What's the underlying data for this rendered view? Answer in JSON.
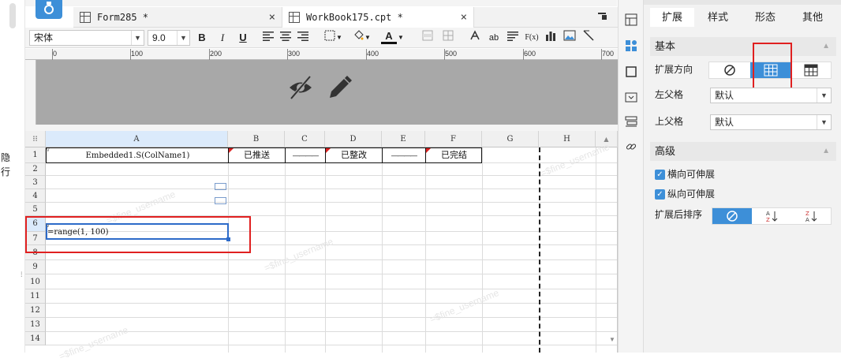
{
  "left_strip": {
    "text1": "隐",
    "text2": "行"
  },
  "tabs": [
    {
      "label": "Form285 *",
      "close": "×"
    },
    {
      "label": "WorkBook175.cpt *",
      "close": "×"
    }
  ],
  "toolbar": {
    "font_name": "宋体",
    "font_size": "9.0",
    "bold": "B",
    "italic": "I",
    "underline": "U",
    "text_color_label": "A",
    "ab_label": "ab",
    "fx_label": "F(x)"
  },
  "ruler": {
    "labels": [
      "0",
      "100",
      "200",
      "300",
      "400",
      "500",
      "600",
      "700"
    ]
  },
  "columns": [
    "A",
    "B",
    "C",
    "D",
    "E",
    "F",
    "G",
    "H"
  ],
  "rows": [
    "1",
    "2",
    "3",
    "4",
    "5",
    "6",
    "7",
    "8",
    "9",
    "10",
    "11",
    "12",
    "13",
    "14"
  ],
  "cells": {
    "a1": "Embedded1.S(ColName1)",
    "b1": "已推送",
    "c1": "————",
    "d1": "已整改",
    "e1": "————",
    "f1": "已完结",
    "a6": "=range(1, 100)"
  },
  "watermark": "=$fine_username",
  "panel": {
    "tabs": [
      "扩展",
      "样式",
      "形态",
      "其他"
    ],
    "basic_section": "基本",
    "expand_direction_label": "扩展方向",
    "left_parent_label": "左父格",
    "left_parent_value": "默认",
    "top_parent_label": "上父格",
    "top_parent_value": "默认",
    "advanced_section": "高级",
    "horizontal_extendable": "横向可伸展",
    "vertical_extendable": "纵向可伸展",
    "sort_after_expand_label": "扩展后排序"
  },
  "colors": {
    "accent": "#3d8fd8",
    "highlight_red": "#e02020"
  }
}
